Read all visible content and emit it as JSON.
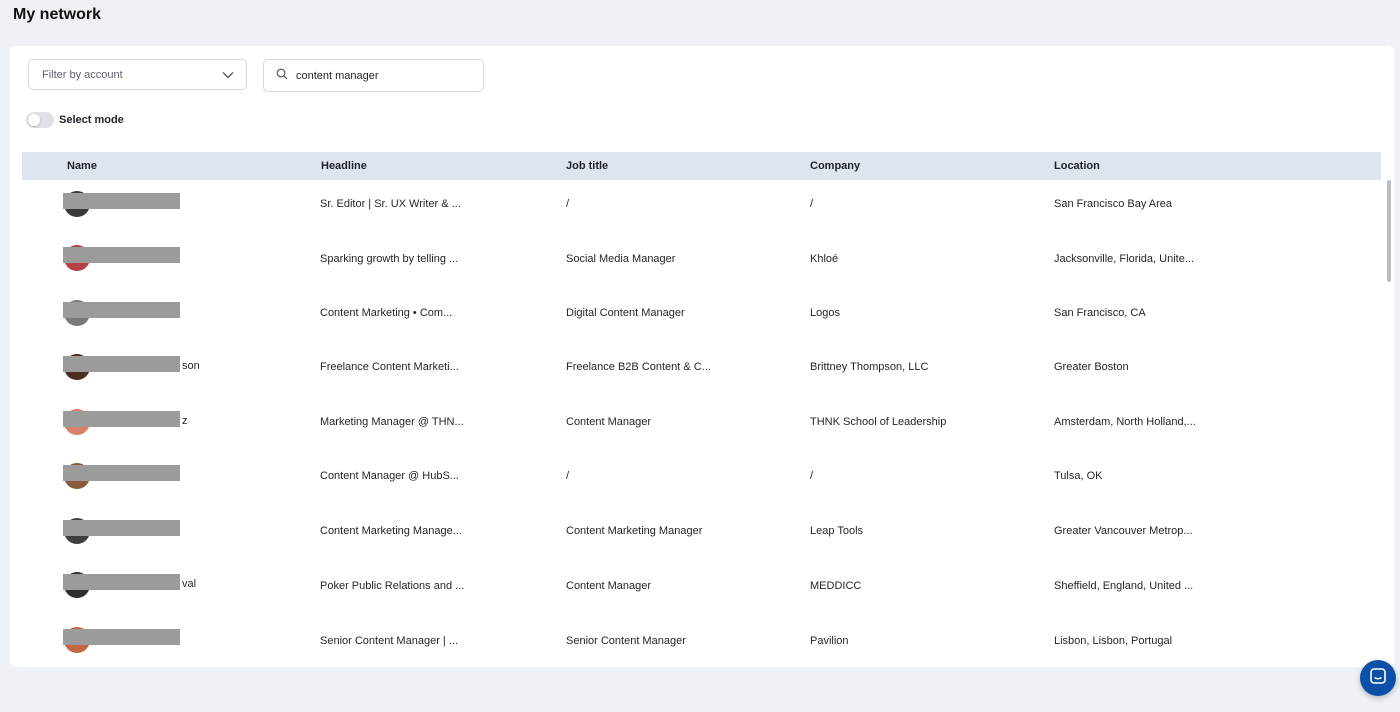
{
  "page": {
    "title": "My network"
  },
  "filters": {
    "account_placeholder": "Filter by account",
    "search_value": "content manager",
    "select_mode_label": "Select mode"
  },
  "columns": {
    "name": "Name",
    "headline": "Headline",
    "job_title": "Job title",
    "company": "Company",
    "location": "Location"
  },
  "rows": [
    {
      "name_tail": "",
      "headline": "Sr. Editor | Sr. UX Writer & ...",
      "job_title": "/",
      "company": "/",
      "location": "San Francisco Bay Area"
    },
    {
      "name_tail": "",
      "headline": "Sparking growth by telling ...",
      "job_title": "Social Media Manager",
      "company": "Khloé",
      "location": "Jacksonville, Florida, Unite..."
    },
    {
      "name_tail": "",
      "headline": "Content Marketing • Com...",
      "job_title": "Digital Content Manager",
      "company": "Logos",
      "location": "San Francisco, CA"
    },
    {
      "name_tail": "son",
      "headline": "Freelance Content Marketi...",
      "job_title": "Freelance B2B Content & C...",
      "company": "Brittney Thompson, LLC",
      "location": "Greater Boston"
    },
    {
      "name_tail": "z",
      "headline": "Marketing Manager @ THN...",
      "job_title": "Content Manager",
      "company": "THNK School of Leadership",
      "location": "Amsterdam, North Holland,..."
    },
    {
      "name_tail": "",
      "headline": "Content Manager @ HubS...",
      "job_title": "/",
      "company": "/",
      "location": "Tulsa, OK"
    },
    {
      "name_tail": "",
      "headline": "Content Marketing Manage...",
      "job_title": "Content Marketing Manager",
      "company": "Leap Tools",
      "location": "Greater Vancouver Metrop..."
    },
    {
      "name_tail": "val",
      "headline": "Poker Public Relations and ...",
      "job_title": "Content Manager",
      "company": "MEDDICC",
      "location": "Sheffield, England, United ..."
    },
    {
      "name_tail": "",
      "headline": "Senior Content Manager | ...",
      "job_title": "Senior Content Manager",
      "company": "Pavilion",
      "location": "Lisbon, Lisbon, Portugal"
    }
  ],
  "icons": {
    "dropdown": "chevron-down-icon",
    "search": "search-icon",
    "chat": "chat-icon"
  },
  "colors": {
    "page_bg": "#eef1f5",
    "header_bg": "#dfe5ee",
    "chat_button": "#0b4fa8",
    "redaction": "#9b9b9b"
  }
}
